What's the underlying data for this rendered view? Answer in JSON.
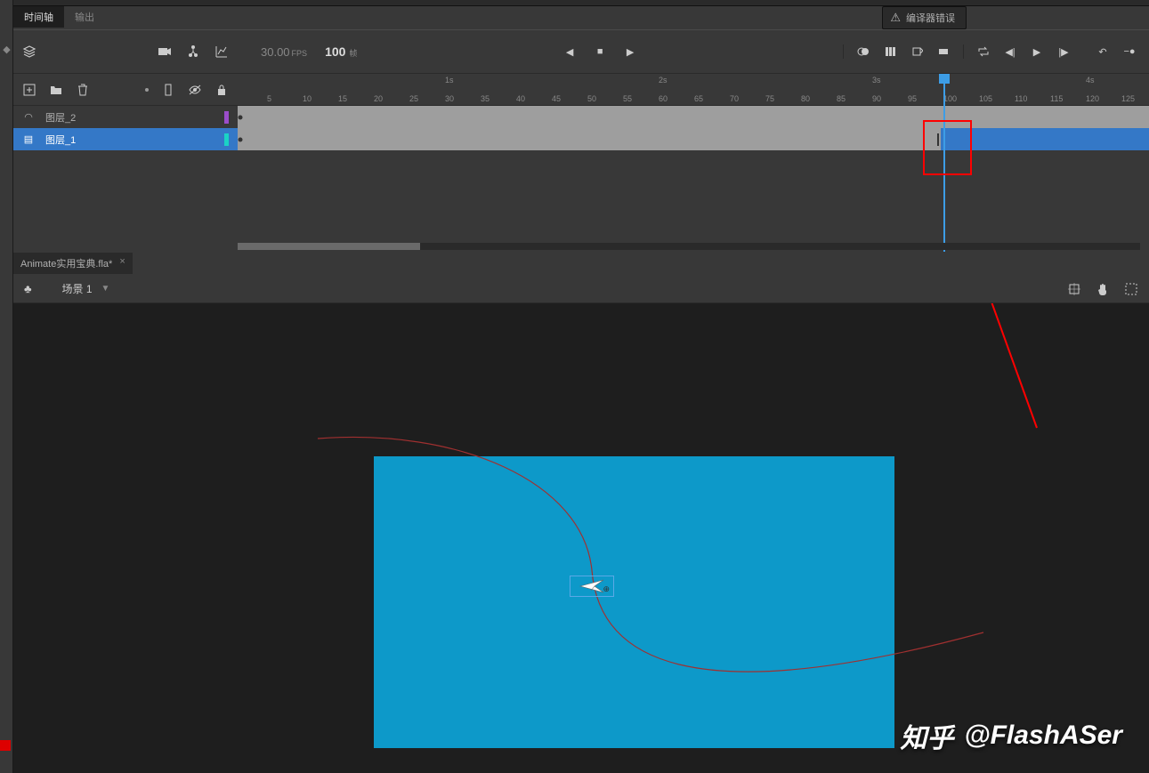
{
  "tabs": {
    "timeline": "时间轴",
    "output": "输出"
  },
  "error_badge": "编译器错误",
  "fps": {
    "value": "30.00",
    "label": "FPS"
  },
  "frame": {
    "value": "100",
    "label": "帧"
  },
  "ruler": {
    "seconds": [
      {
        "label": "1s",
        "pos": 233
      },
      {
        "label": "2s",
        "pos": 473
      },
      {
        "label": "3s",
        "pos": 713
      },
      {
        "label": "4s",
        "pos": 953
      }
    ],
    "ticks": [
      {
        "label": "5",
        "pos": 33
      },
      {
        "label": "10",
        "pos": 73
      },
      {
        "label": "15",
        "pos": 113
      },
      {
        "label": "20",
        "pos": 153
      },
      {
        "label": "25",
        "pos": 193
      },
      {
        "label": "30",
        "pos": 233
      },
      {
        "label": "35",
        "pos": 273
      },
      {
        "label": "40",
        "pos": 313
      },
      {
        "label": "45",
        "pos": 353
      },
      {
        "label": "50",
        "pos": 393
      },
      {
        "label": "55",
        "pos": 433
      },
      {
        "label": "60",
        "pos": 473
      },
      {
        "label": "65",
        "pos": 513
      },
      {
        "label": "70",
        "pos": 553
      },
      {
        "label": "75",
        "pos": 593
      },
      {
        "label": "80",
        "pos": 633
      },
      {
        "label": "85",
        "pos": 673
      },
      {
        "label": "90",
        "pos": 713
      },
      {
        "label": "95",
        "pos": 753
      },
      {
        "label": "100",
        "pos": 793
      },
      {
        "label": "105",
        "pos": 833
      },
      {
        "label": "110",
        "pos": 873
      },
      {
        "label": "115",
        "pos": 913
      },
      {
        "label": "120",
        "pos": 953
      },
      {
        "label": "125",
        "pos": 993
      }
    ]
  },
  "layers": [
    {
      "name": "图层_2",
      "color": "#9b4dca",
      "selected": false,
      "icon": "motion"
    },
    {
      "name": "图层_1",
      "color": "#1bd3c5",
      "selected": true,
      "icon": "layer"
    }
  ],
  "playhead_frame": 100,
  "doc_tab": "Animate实用宝典.fla*",
  "scene": "场景 1",
  "watermark": {
    "logo": "知乎",
    "handle": "@FlashASer"
  },
  "annotation": {
    "red_box_frame": 100
  }
}
